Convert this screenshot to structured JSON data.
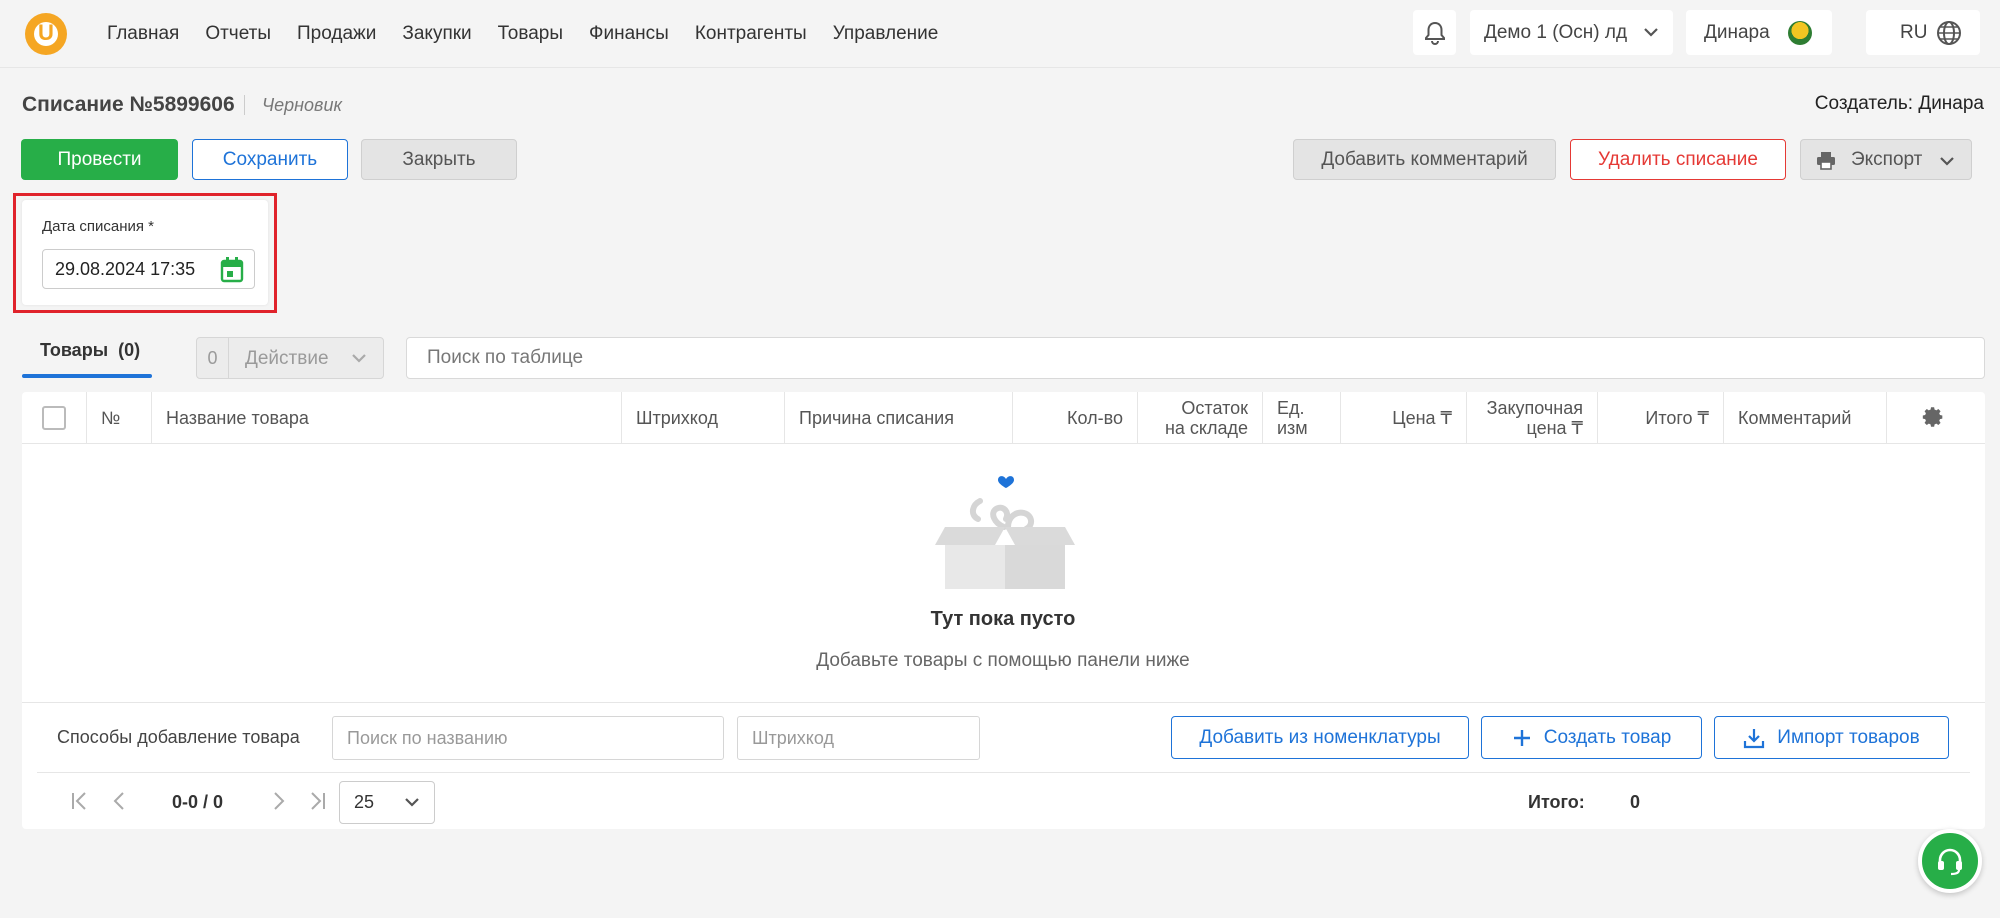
{
  "nav": [
    "Главная",
    "Отчеты",
    "Продажи",
    "Закупки",
    "Товары",
    "Финансы",
    "Контрагенты",
    "Управление"
  ],
  "topbar": {
    "logo_letter": "U",
    "organization": "Демо 1 (Осн) лд",
    "user": "Динара",
    "language": "RU"
  },
  "document": {
    "title": "Списание №5899606",
    "status": "Черновик",
    "creator": "Создатель: Динара"
  },
  "actions": {
    "post": "Провести",
    "save": "Сохранить",
    "close": "Закрыть",
    "add_comment": "Добавить комментарий",
    "delete": "Удалить списание",
    "export": "Экспорт"
  },
  "date_field": {
    "label": "Дата списания *",
    "value": "29.08.2024 17:35"
  },
  "tabs": {
    "goods": "Товары",
    "goods_count": "(0)"
  },
  "bulk_action": {
    "count": "0",
    "label": "Действие"
  },
  "table_search": {
    "placeholder": "Поиск по таблице"
  },
  "columns": {
    "num": "№",
    "name": "Название товара",
    "barcode": "Штрихкод",
    "reason": "Причина списания",
    "qty": "Кол-во",
    "stock_1": "Остаток",
    "stock_2": "на складе",
    "unit_1": "Ед.",
    "unit_2": "изм",
    "price": "Цена ₸",
    "purchase_1": "Закупочная",
    "purchase_2": "цена ₸",
    "total": "Итого ₸",
    "comment": "Комментарий"
  },
  "empty": {
    "title": "Тут пока пусто",
    "subtitle": "Добавьте товары с помощью панели ниже"
  },
  "add_bar": {
    "label": "Способы добавление товара",
    "name_placeholder": "Поиск по названию",
    "barcode_placeholder": "Штрихкод",
    "from_nomenclature": "Добавить из номенклатуры",
    "create": "Создать товар",
    "import": "Импорт товаров"
  },
  "pager": {
    "range": "0-0 / 0",
    "per_page": "25",
    "total_label": "Итого:",
    "total_value": "0"
  },
  "colors": {
    "primary_green": "#27ae48",
    "primary_blue": "#1e73d8",
    "danger": "#e53935",
    "logo": "#f5a623",
    "highlight": "#e0232b"
  }
}
